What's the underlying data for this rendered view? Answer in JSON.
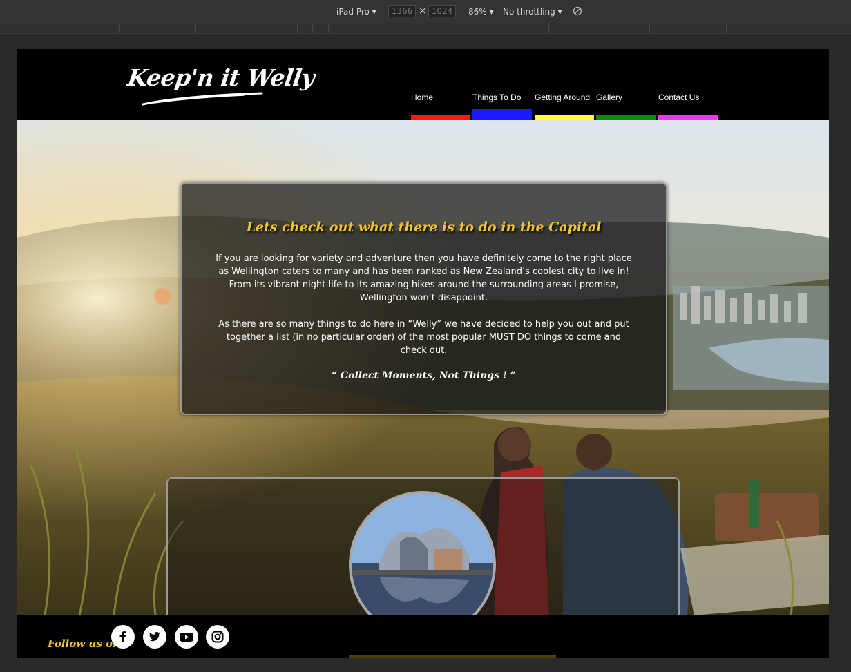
{
  "devtools": {
    "device": "iPad Pro",
    "width_value": "1366",
    "height_value": "1024",
    "times_symbol": "×",
    "zoom": "86%",
    "throttling": "No throttling",
    "rotate_icon": "rotate-icon"
  },
  "site": {
    "logo_text": "Keep'n it Welly",
    "nav": [
      {
        "label": "Home",
        "color": "#ff1a1a",
        "active": false
      },
      {
        "label": "Things To Do",
        "color": "#1a1aff",
        "active": true
      },
      {
        "label": "Getting Around",
        "color": "#ffff33",
        "active": false
      },
      {
        "label": "Gallery",
        "color": "#0a8a0a",
        "active": false
      },
      {
        "label": "Contact Us",
        "color": "#ff33ff",
        "active": false
      }
    ],
    "intro": {
      "heading": "Lets check out what there is to do in the Capital",
      "paragraph_1": "If you are looking for variety and adventure then you have definitely come to the right place as Wellington caters to many and has been ranked as New Zealand’s coolest city to live in! From its vibrant night life to its amazing hikes around the surrounding areas I promise, Wellington won’t disappoint.",
      "paragraph_2": "As there are so many things to do here in “Welly” we have decided to help you out and put together a list (in no particular order) of the most popular MUST DO things to come and check out.",
      "quote": "“ Collect Moments, Not Things ! ”"
    },
    "footer": {
      "follow_label": "Follow us on:",
      "social": [
        "facebook-icon",
        "twitter-icon",
        "youtube-icon",
        "instagram-icon"
      ]
    },
    "accent_color": "#f4c430"
  }
}
